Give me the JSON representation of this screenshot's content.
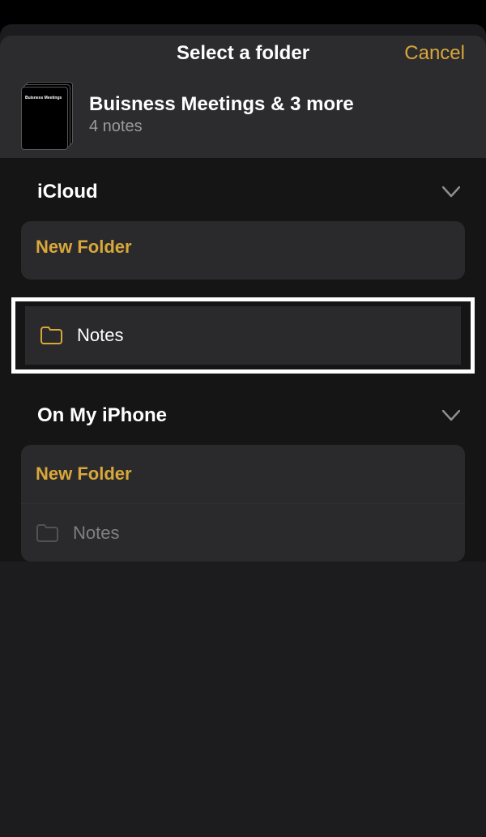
{
  "colors": {
    "accent": "#d9a73a"
  },
  "nav": {
    "title": "Select a folder",
    "cancel": "Cancel"
  },
  "context": {
    "stack_label": "Buisness Meetings",
    "title": "Buisness Meetings & 3 more",
    "subtitle": "4 notes"
  },
  "accounts": [
    {
      "name": "iCloud",
      "expanded": true,
      "new_folder_label": "New Folder",
      "folders": [
        {
          "label": "Notes",
          "enabled": true,
          "highlighted": true
        }
      ]
    },
    {
      "name": "On My iPhone",
      "expanded": true,
      "new_folder_label": "New Folder",
      "folders": [
        {
          "label": "Notes",
          "enabled": false,
          "highlighted": false
        }
      ]
    }
  ]
}
